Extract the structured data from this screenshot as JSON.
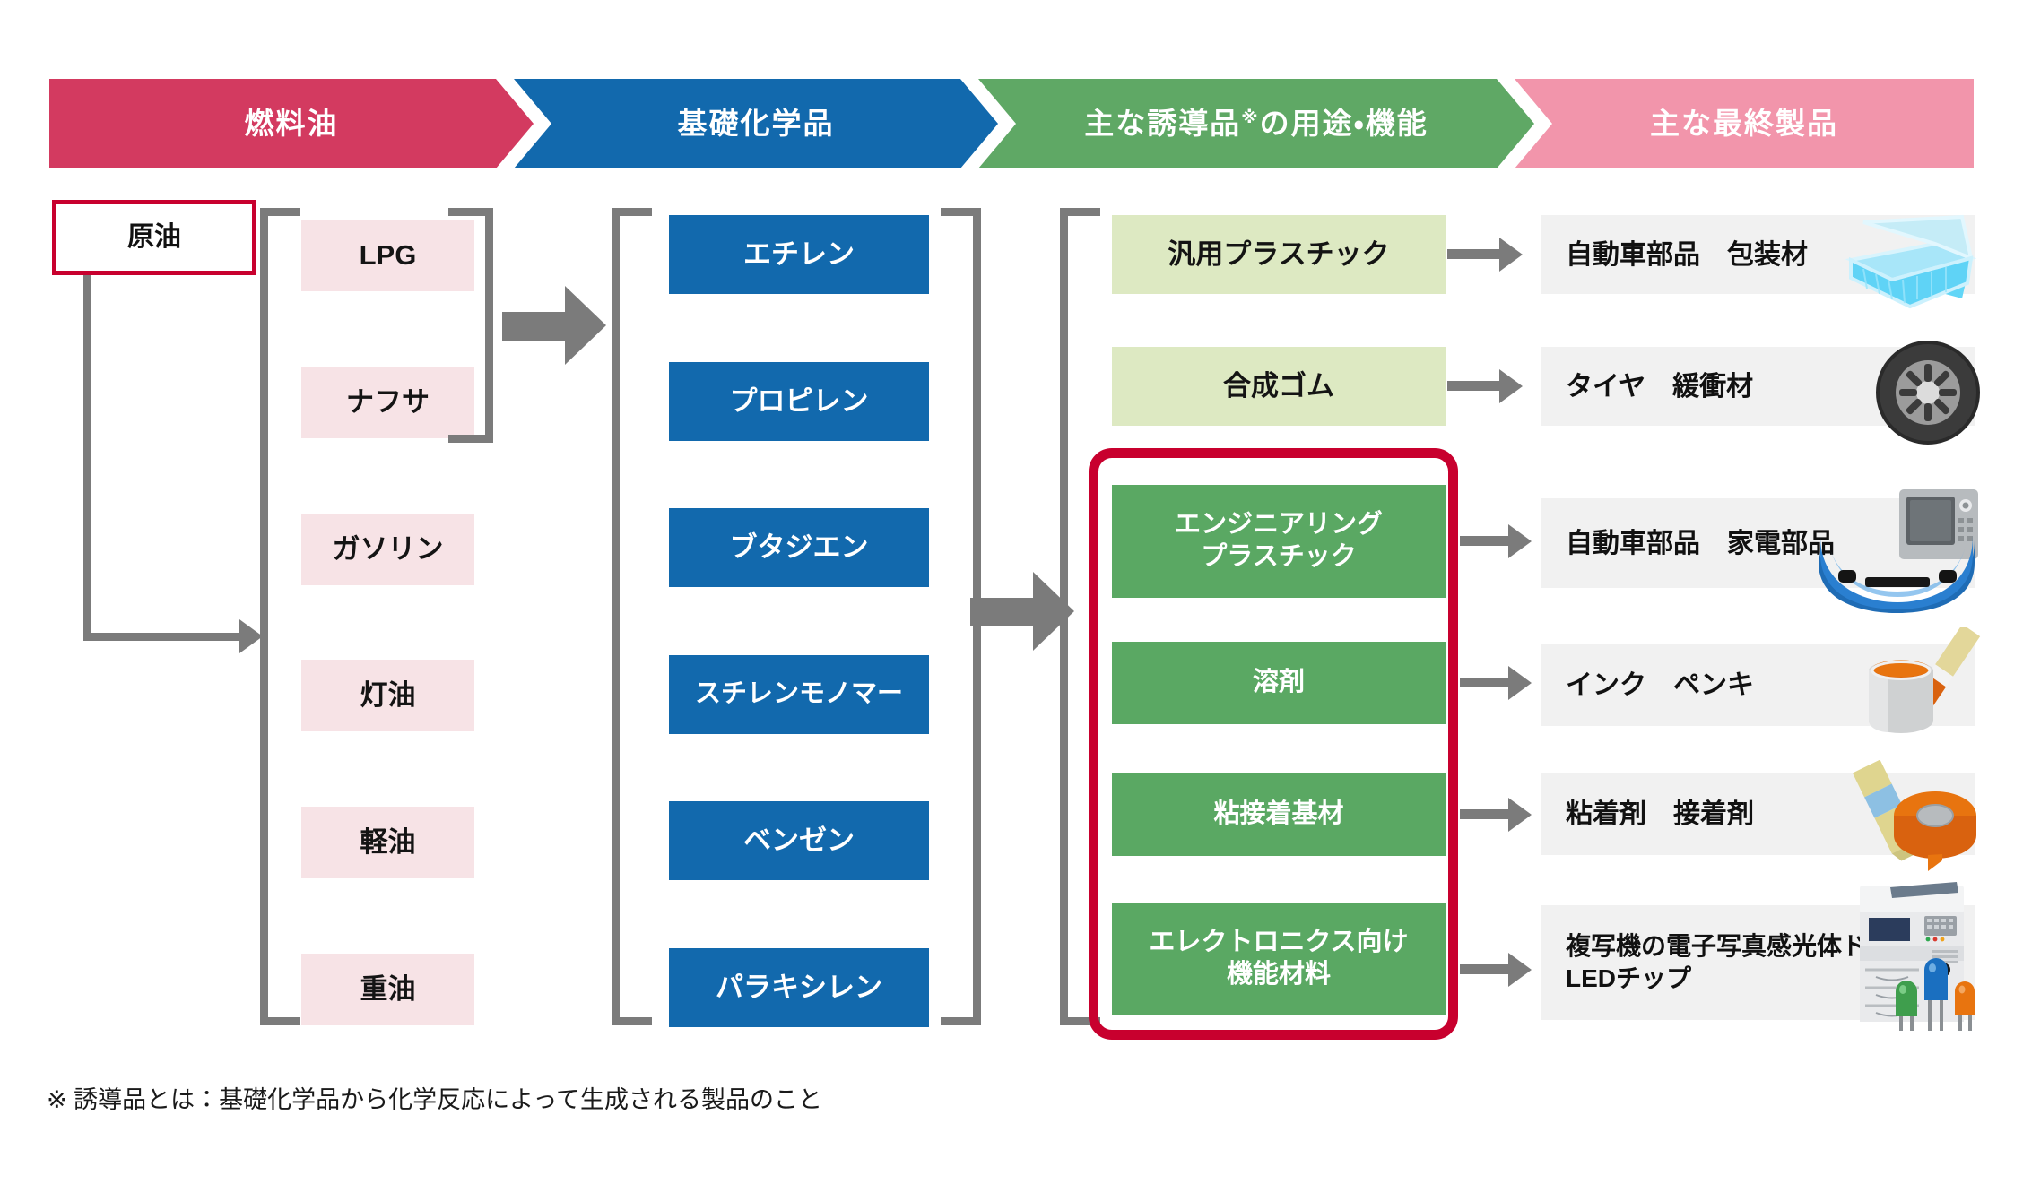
{
  "header": {
    "bands": [
      {
        "label": "燃料油",
        "color": "#d33a60"
      },
      {
        "label": "基礎化学品",
        "color": "#1269ad"
      },
      {
        "label": "主な誘導品",
        "suffix": "の用途・機能",
        "mark": "※",
        "color": "#5fa865"
      },
      {
        "label": "主な最終製品",
        "color": "#f295ab"
      }
    ]
  },
  "source": {
    "label": "原油"
  },
  "fuel_oils": {
    "items": [
      {
        "label": "LPG"
      },
      {
        "label": "ナフサ"
      },
      {
        "label": "ガソリン"
      },
      {
        "label": "灯油"
      },
      {
        "label": "軽油"
      },
      {
        "label": "重油"
      }
    ]
  },
  "basic_chemicals": {
    "items": [
      {
        "label": "エチレン"
      },
      {
        "label": "プロピレン"
      },
      {
        "label": "ブタジエン"
      },
      {
        "label": "スチレンモノマー"
      },
      {
        "label": "ベンゼン"
      },
      {
        "label": "パラキシレン"
      }
    ]
  },
  "derivatives": {
    "items": [
      {
        "label": "汎用プラスチック",
        "style": "light",
        "highlighted": false
      },
      {
        "label": "合成ゴム",
        "style": "light",
        "highlighted": false
      },
      {
        "label": "エンジニアリング\nプラスチック",
        "style": "dark",
        "highlighted": true
      },
      {
        "label": "溶剤",
        "style": "dark",
        "highlighted": true
      },
      {
        "label": "粘接着基材",
        "style": "dark",
        "highlighted": true
      },
      {
        "label": "エレクトロニクス向け\n機能材料",
        "style": "dark",
        "highlighted": true
      }
    ]
  },
  "final_products": {
    "items": [
      {
        "label": "自動車部品　包装材",
        "icon": "plastic-container-icon"
      },
      {
        "label": "タイヤ　緩衝材",
        "icon": "tire-icon"
      },
      {
        "label": "自動車部品　家電部品",
        "icon": "car-bumper-microwave-icon"
      },
      {
        "label": "インク　ペンキ",
        "icon": "paint-can-brush-icon"
      },
      {
        "label": "粘着剤　接着剤",
        "icon": "glue-tape-icon"
      },
      {
        "label": "複写機の電子写真感光体ドラム\nLEDチップ",
        "icon": "copier-led-icon"
      }
    ]
  },
  "footnote": {
    "text": "※  誘導品とは：基礎化学品から化学反応によって生成される製品のこと"
  },
  "colors": {
    "fuel_band": "#d33a60",
    "basic_band": "#1269ad",
    "deriv_band": "#5fa865",
    "final_band": "#f295ab",
    "pink_box": "#f7e3e6",
    "blue_box": "#1269ad",
    "light_green_box": "#dde9c2",
    "dark_green_box": "#5aa863",
    "product_row": "#f1f1f1",
    "highlight_border": "#c8002e",
    "connector": "#7b7b7b"
  }
}
